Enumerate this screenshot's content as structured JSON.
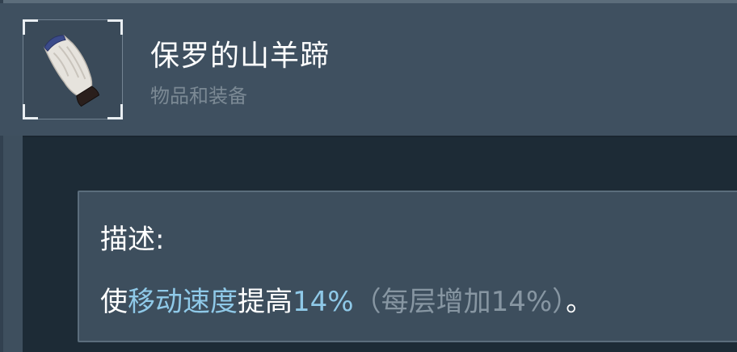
{
  "item": {
    "name": "保罗的山羊蹄",
    "category": "物品和装备",
    "icon": "goat-hoof-icon"
  },
  "description": {
    "label": "描述:",
    "segments": {
      "s1": "使",
      "s2": "移动速度",
      "s3": "提高",
      "s4": "14%",
      "s5": "（每层增加14%）",
      "s6": "。"
    }
  },
  "colors": {
    "highlight": "#8fc9e8",
    "stack_note": "#8796a2",
    "text": "#ffffff"
  }
}
